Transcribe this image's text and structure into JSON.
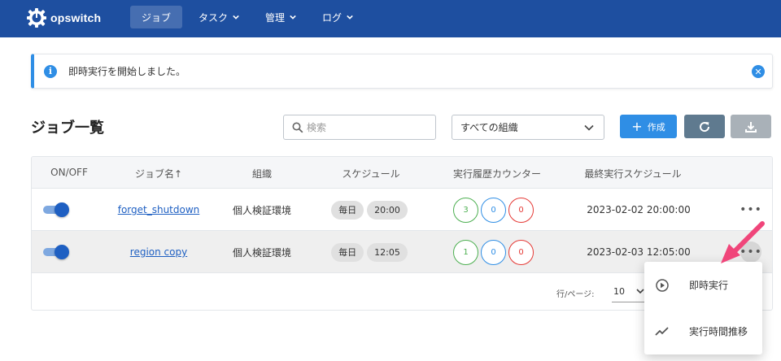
{
  "app": {
    "name": "opswitch"
  },
  "nav": {
    "items": [
      {
        "label": "ジョブ",
        "active": true
      },
      {
        "label": "タスク",
        "dropdown": true
      },
      {
        "label": "管理",
        "dropdown": true
      },
      {
        "label": "ログ",
        "dropdown": true
      }
    ]
  },
  "alert": {
    "message": "即時実行を開始しました。",
    "icon": "info-icon",
    "close_icon": "close-icon"
  },
  "page": {
    "title": "ジョブ一覧"
  },
  "search": {
    "placeholder": "検索",
    "value": ""
  },
  "org_filter": {
    "selected": "すべての組織"
  },
  "toolbar": {
    "create_label": "作成",
    "refresh_icon": "refresh-icon",
    "download_icon": "download-icon"
  },
  "table": {
    "columns": [
      "ON/OFF",
      "ジョブ名",
      "組織",
      "スケジュール",
      "実行履歴カウンター",
      "最終実行スケジュール"
    ],
    "sort_indicator": "↑",
    "rows": [
      {
        "enabled": true,
        "job_name": "forget_shutdown",
        "org": "個人検証環境",
        "schedule": [
          "毎日",
          "20:00"
        ],
        "counters": [
          "3",
          "0",
          "0"
        ],
        "last_run": "2023-02-02 20:00:00"
      },
      {
        "enabled": true,
        "job_name": "region copy",
        "org": "個人検証環境",
        "schedule": [
          "毎日",
          "12:05"
        ],
        "counters": [
          "1",
          "0",
          "0"
        ],
        "last_run": "2023-02-03 12:05:00"
      }
    ],
    "footer": {
      "rows_per_page_label": "行/ページ:",
      "rows_per_page_value": "10"
    }
  },
  "context_menu": {
    "items": [
      {
        "label": "即時実行",
        "icon": "play-circle-icon"
      },
      {
        "label": "実行時間推移",
        "icon": "trend-line-icon"
      }
    ]
  },
  "colors": {
    "header_bg": "#1e4fa0",
    "primary": "#2f8ee5",
    "success": "#4caf50",
    "danger": "#e53935",
    "annotation_arrow": "#f0457a"
  }
}
